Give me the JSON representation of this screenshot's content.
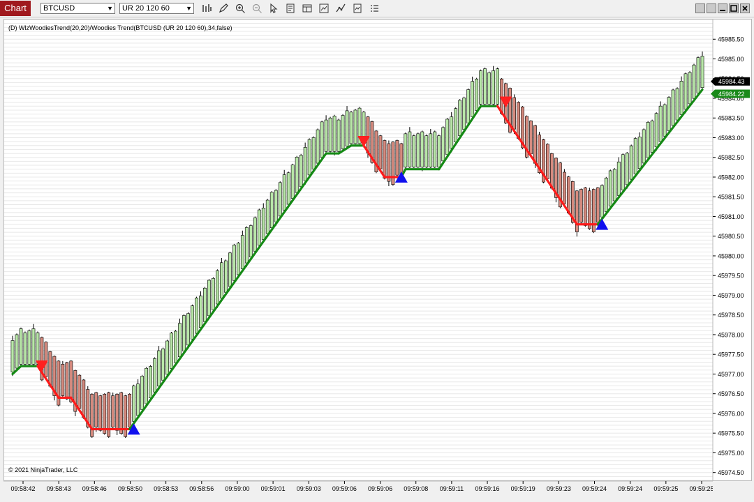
{
  "app": {
    "tab_label": "Chart",
    "instrument": "BTCUSD",
    "bar_type": "UR 20 120 60"
  },
  "toolbar": {
    "icons": [
      "bar-type-icon",
      "draw-pencil-icon",
      "zoom-in-icon",
      "zoom-out-icon",
      "pointer-icon",
      "data-box-icon",
      "properties-icon",
      "chart-trader-icon",
      "strategies-icon",
      "more-menu-icon"
    ]
  },
  "colors": {
    "up_bar": "#b8e6a8",
    "down_bar": "#d58a7e",
    "uptrend_line": "#158a15",
    "downtrend_line": "#ff1a1a",
    "buy_arrow": "#1010ee",
    "sell_arrow": "#ff2020",
    "grid": "#e8e8e8",
    "price_marker_last": "#000000",
    "price_marker_indicator": "#1a8a1a"
  },
  "chart_data": {
    "type": "candlestick",
    "title": "(D) WlzWoodiesTrend(20,20)/Woodies Trend(BTCUSD (UR 20 120 60),34,false)",
    "copyright": "© 2021 NinjaTrader, LLC",
    "y_ticks": [
      "45985.50",
      "45985.00",
      "45984.50",
      "45984.00",
      "45983.50",
      "45983.00",
      "45982.50",
      "45982.00",
      "45981.50",
      "45981.00",
      "45980.50",
      "45980.00",
      "45979.50",
      "45979.00",
      "45978.50",
      "45978.00",
      "45977.50",
      "45977.00",
      "45976.50",
      "45976.00",
      "45975.50",
      "45975.00",
      "45974.50"
    ],
    "ylim": [
      45974.3,
      45986.0
    ],
    "x_ticks": [
      "09:58:42",
      "09:58:43",
      "09:58:46",
      "09:58:50",
      "09:58:53",
      "09:58:56",
      "09:59:00",
      "09:59:01",
      "09:59:03",
      "09:59:06",
      "09:59:06",
      "09:59:08",
      "09:59:11",
      "09:59:16",
      "09:59:19",
      "09:59:23",
      "09:59:24",
      "09:59:24",
      "09:59:25",
      "09:59:25"
    ],
    "last_price_label": "45984.43",
    "indicator_price_label": "45984.22",
    "bar_count": 166,
    "trend_line": [
      {
        "i": 0,
        "v": 45977.0,
        "c": "up"
      },
      {
        "i": 2,
        "v": 45977.2,
        "c": "up"
      },
      {
        "i": 6,
        "v": 45977.2,
        "c": "up"
      },
      {
        "i": 11,
        "v": 45976.4,
        "c": "down"
      },
      {
        "i": 14,
        "v": 45976.4,
        "c": "down"
      },
      {
        "i": 19,
        "v": 45975.6,
        "c": "down"
      },
      {
        "i": 28,
        "v": 45975.6,
        "c": "down"
      },
      {
        "i": 75,
        "v": 45982.6,
        "c": "up"
      },
      {
        "i": 78,
        "v": 45982.6,
        "c": "up"
      },
      {
        "i": 81,
        "v": 45982.8,
        "c": "up"
      },
      {
        "i": 84,
        "v": 45982.8,
        "c": "up"
      },
      {
        "i": 89,
        "v": 45982.0,
        "c": "down"
      },
      {
        "i": 93,
        "v": 45982.0,
        "c": "down"
      },
      {
        "i": 94,
        "v": 45982.2,
        "c": "up"
      },
      {
        "i": 102,
        "v": 45982.2,
        "c": "up"
      },
      {
        "i": 112,
        "v": 45983.8,
        "c": "up"
      },
      {
        "i": 116,
        "v": 45983.8,
        "c": "up"
      },
      {
        "i": 135,
        "v": 45980.8,
        "c": "down"
      },
      {
        "i": 140,
        "v": 45980.8,
        "c": "down"
      },
      {
        "i": 165,
        "v": 45984.22,
        "c": "up"
      }
    ],
    "signals": [
      {
        "i": 7,
        "v": 45977.22,
        "kind": "sell"
      },
      {
        "i": 29,
        "v": 45975.62,
        "kind": "buy"
      },
      {
        "i": 84,
        "v": 45982.92,
        "kind": "sell"
      },
      {
        "i": 93,
        "v": 45982.02,
        "kind": "buy"
      },
      {
        "i": 118,
        "v": 45983.92,
        "kind": "sell"
      },
      {
        "i": 141,
        "v": 45980.82,
        "kind": "buy"
      }
    ]
  }
}
